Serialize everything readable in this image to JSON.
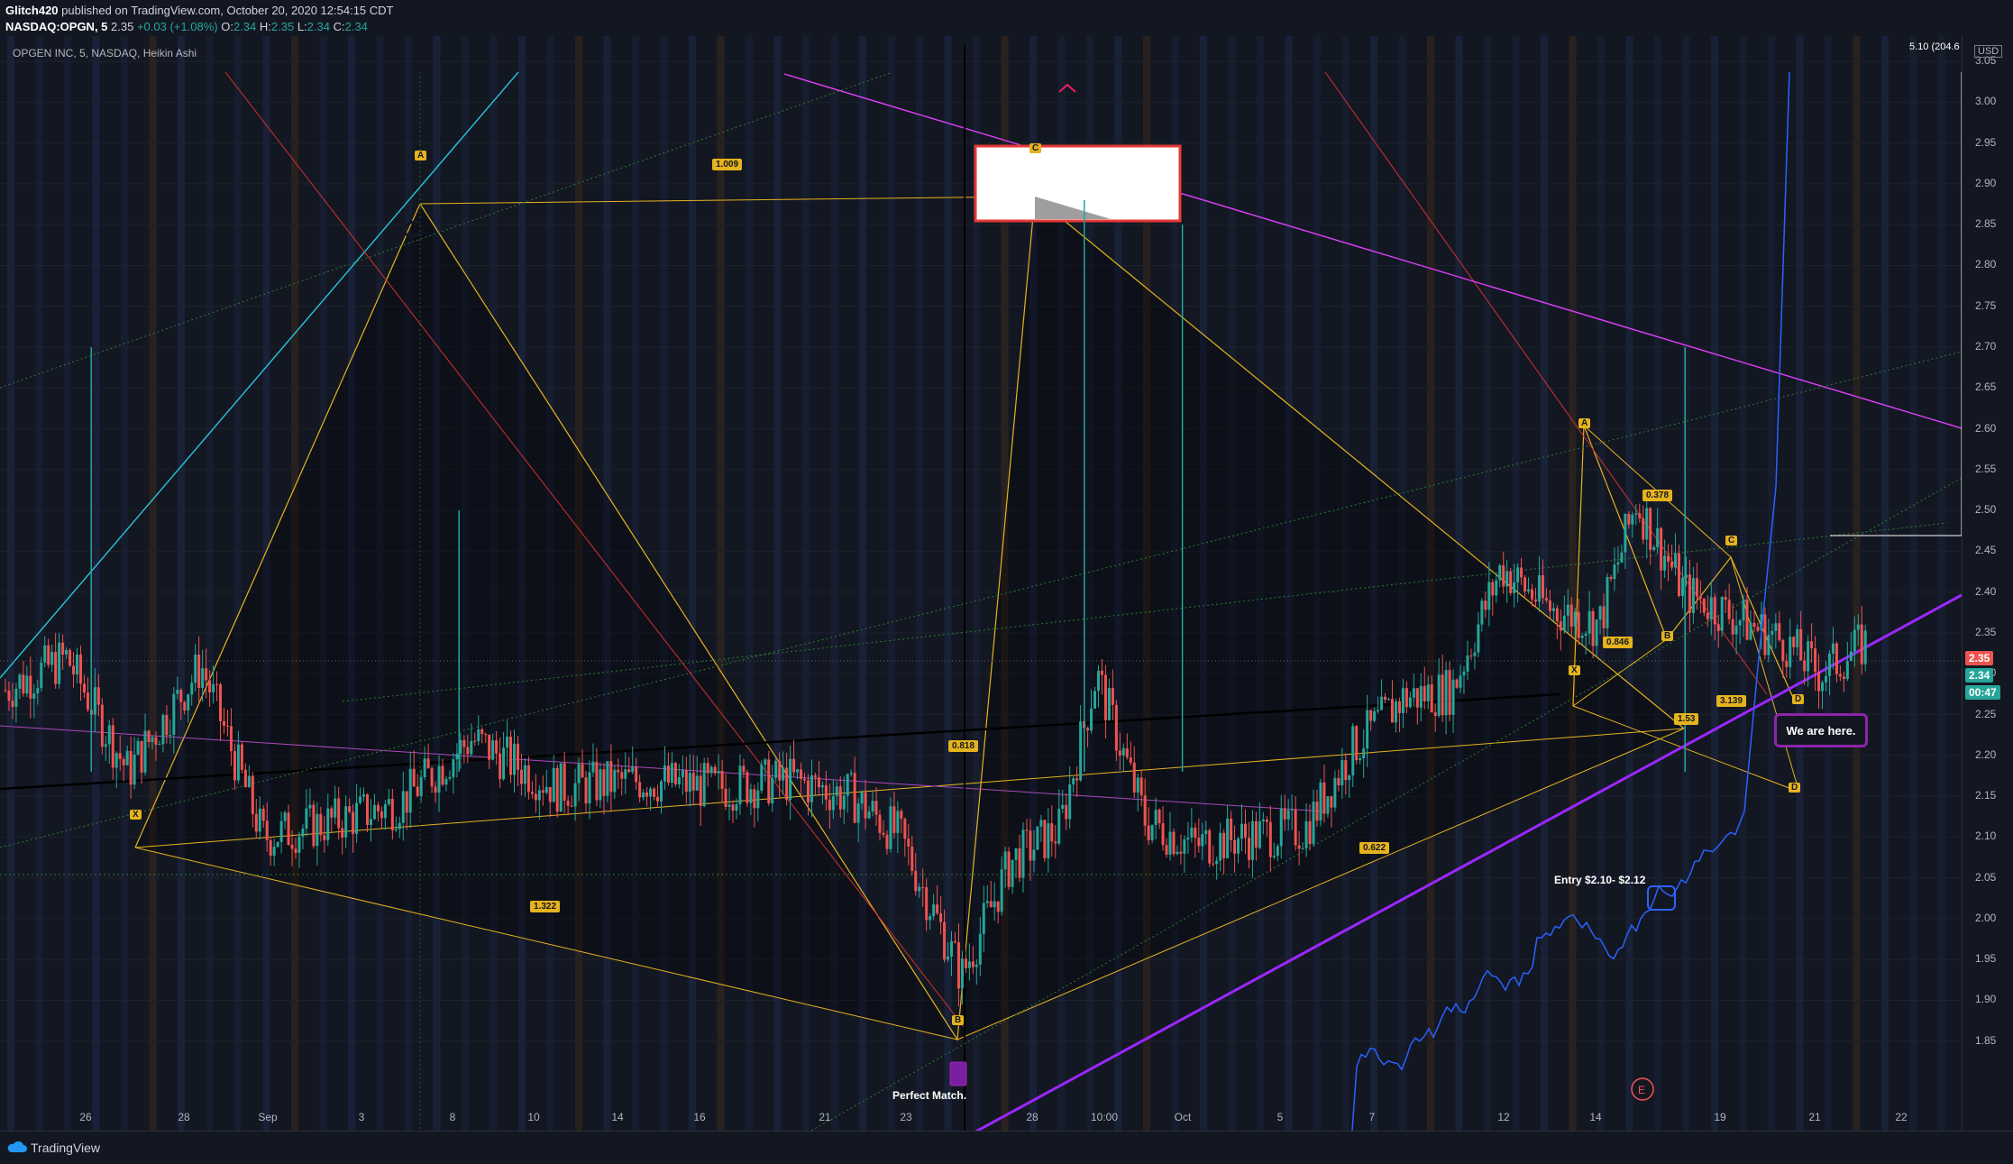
{
  "header": {
    "author": "Glitch420",
    "published": "published on TradingView.com, October 20, 2020 12:54:15 CDT",
    "symbol": "NASDAQ:OPGN, 5",
    "last": "2.35",
    "change": "+0.03 (+1.08%)",
    "o_label": "O:",
    "o": "2.34",
    "h_label": "H:",
    "h": "2.35",
    "l_label": "L:",
    "l": "2.34",
    "c_label": "C:",
    "c": "2.34"
  },
  "title": "OPGEN INC, 5, NASDAQ, Heikin Ashi",
  "currency": "USD",
  "top_price_label": "5.10 (204.6",
  "footer": {
    "logo": "TradingView"
  },
  "annotations": {
    "we_are_here": "We are here.",
    "entry": "Entry $2.10- $2.12",
    "perfect_match": "Perfect Match."
  },
  "pattern_ratios": [
    {
      "label": "1.009"
    },
    {
      "label": "0.818"
    },
    {
      "label": "1.322"
    },
    {
      "label": "0.622"
    },
    {
      "label": "0.378"
    },
    {
      "label": "0.846"
    },
    {
      "label": "1.53"
    },
    {
      "label": "3.139"
    }
  ],
  "pattern_points": [
    "X",
    "A",
    "B",
    "C",
    "D",
    "X",
    "A",
    "B",
    "C",
    "D",
    "D"
  ],
  "price_tags": {
    "last": "2.35",
    "close": "2.34",
    "countdown": "00:47"
  },
  "colors": {
    "background": "#131722",
    "bull": "#26a69a",
    "bear": "#ef5350",
    "pattern": "#e6b31e",
    "magenta": "#e040fb",
    "purple": "#9c27ff",
    "cyan": "#26c6da",
    "blue": "#2962ff"
  },
  "chart_data": {
    "type": "candlestick",
    "style": "Heikin Ashi",
    "ylim": [
      1.8,
      3.07
    ],
    "yticks": [
      "3.05",
      "3.00",
      "2.95",
      "2.90",
      "2.85",
      "2.80",
      "2.75",
      "2.70",
      "2.65",
      "2.60",
      "2.55",
      "2.50",
      "2.45",
      "2.40",
      "2.35",
      "2.30",
      "2.25",
      "2.20",
      "2.15",
      "2.10",
      "2.05",
      "2.00",
      "1.95",
      "1.90",
      "1.85"
    ],
    "xticks": [
      "26",
      "28",
      "Sep",
      "3",
      "8",
      "10",
      "14",
      "16",
      "21",
      "23",
      "28",
      "10:00",
      "Oct",
      "5",
      "7",
      "12",
      "14",
      "19",
      "21",
      "22"
    ],
    "price_path": [
      {
        "x": 0,
        "y": 2.28
      },
      {
        "x": 5,
        "y": 2.32
      },
      {
        "x": 10,
        "y": 2.18
      },
      {
        "x": 16,
        "y": 2.31
      },
      {
        "x": 21,
        "y": 2.1
      },
      {
        "x": 27,
        "y": 2.12
      },
      {
        "x": 32,
        "y": 2.14
      },
      {
        "x": 38,
        "y": 2.22
      },
      {
        "x": 45,
        "y": 2.16
      },
      {
        "x": 52,
        "y": 2.17
      },
      {
        "x": 58,
        "y": 2.16
      },
      {
        "x": 64,
        "y": 2.17
      },
      {
        "x": 69,
        "y": 2.15
      },
      {
        "x": 73,
        "y": 2.1
      },
      {
        "x": 78,
        "y": 1.93
      },
      {
        "x": 82,
        "y": 2.07
      },
      {
        "x": 86,
        "y": 2.11
      },
      {
        "x": 89,
        "y": 2.3
      },
      {
        "x": 93,
        "y": 2.12
      },
      {
        "x": 97,
        "y": 2.09
      },
      {
        "x": 101,
        "y": 2.1
      },
      {
        "x": 106,
        "y": 2.11
      },
      {
        "x": 110,
        "y": 2.21
      },
      {
        "x": 114,
        "y": 2.27
      },
      {
        "x": 118,
        "y": 2.28
      },
      {
        "x": 122,
        "y": 2.43
      },
      {
        "x": 126,
        "y": 2.38
      },
      {
        "x": 130,
        "y": 2.36
      },
      {
        "x": 133,
        "y": 2.51
      },
      {
        "x": 137,
        "y": 2.4
      },
      {
        "x": 141,
        "y": 2.37
      },
      {
        "x": 145,
        "y": 2.34
      },
      {
        "x": 148,
        "y": 2.3
      },
      {
        "x": 152,
        "y": 2.34
      }
    ],
    "spikes": [
      {
        "x": 7,
        "y": 2.7
      },
      {
        "x": 37,
        "y": 2.5
      },
      {
        "x": 88,
        "y": 2.88
      },
      {
        "x": 96,
        "y": 2.85
      },
      {
        "x": 137,
        "y": 2.7
      }
    ],
    "xlim": [
      0,
      160
    ],
    "current_price": 2.35
  }
}
